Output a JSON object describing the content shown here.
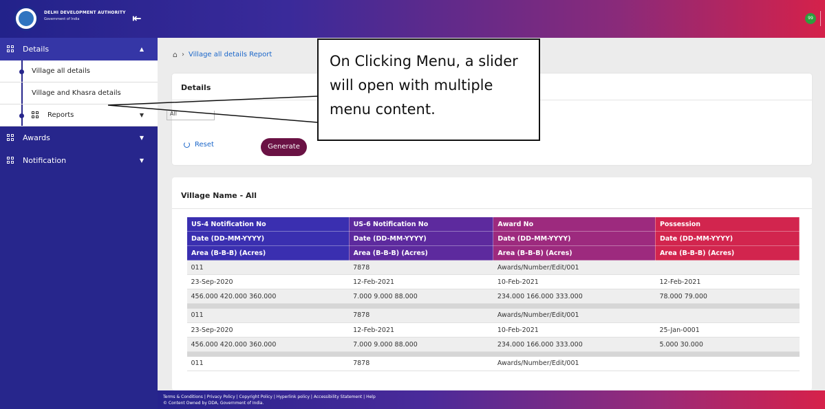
{
  "header": {
    "org_name": "DELHI DEVELOPMENT AUTHORITY",
    "org_sub": "Government of India",
    "menu_toggle_icon": "menu-collapse-icon",
    "notification_count": "99"
  },
  "sidebar": {
    "sections": [
      {
        "label": "Details",
        "icon": "grid-icon",
        "expanded": true
      },
      {
        "label": "Awards",
        "icon": "grid-icon"
      },
      {
        "label": "Notification",
        "icon": "grid-icon"
      }
    ],
    "details_items": [
      "Village all details",
      "Village and Khasra details",
      "Reports"
    ]
  },
  "breadcrumb": {
    "current": "Village all details Report"
  },
  "filter_card": {
    "title": "Details",
    "select_value": "All",
    "reset_label": "Reset",
    "generate_label": "Generate"
  },
  "report": {
    "title": "Village Name - All",
    "columns": [
      "US-4 Notification No",
      "US-6 Notification No",
      "Award No",
      "Possession"
    ],
    "subheader1": [
      "Date (DD-MM-YYYY)",
      "Date (DD-MM-YYYY)",
      "Date (DD-MM-YYYY)",
      "Date (DD-MM-YYYY)"
    ],
    "subheader2": [
      "Area (B-B-B) (Acres)",
      "Area (B-B-B) (Acres)",
      "Area (B-B-B) (Acres)",
      "Area (B-B-B) (Acres)"
    ],
    "groups": [
      {
        "no": [
          "011",
          "7878",
          "Awards/Number/Edit/001",
          ""
        ],
        "date": [
          "23-Sep-2020",
          "12-Feb-2021",
          "10-Feb-2021",
          "12-Feb-2021"
        ],
        "area": [
          "456.000 420.000 360.000",
          "7.000 9.000 88.000",
          "234.000 166.000 333.000",
          "78.000 79.000"
        ]
      },
      {
        "no": [
          "011",
          "7878",
          "Awards/Number/Edit/001",
          ""
        ],
        "date": [
          "23-Sep-2020",
          "12-Feb-2021",
          "10-Feb-2021",
          "25-Jan-0001"
        ],
        "area": [
          "456.000 420.000 360.000",
          "7.000 9.000 88.000",
          "234.000 166.000 333.000",
          "5.000 30.000"
        ]
      },
      {
        "no": [
          "011",
          "7878",
          "Awards/Number/Edit/001",
          ""
        ]
      }
    ]
  },
  "footer": {
    "links": "Terms & Conditions | Privacy Policy | Copyright Policy | Hyperlink policy | Accessibility Statement | Help",
    "copyright": "© Content Owned by DDA, Government of India."
  },
  "callout": {
    "text": "On Clicking Menu, a slider will open with multiple menu content."
  }
}
